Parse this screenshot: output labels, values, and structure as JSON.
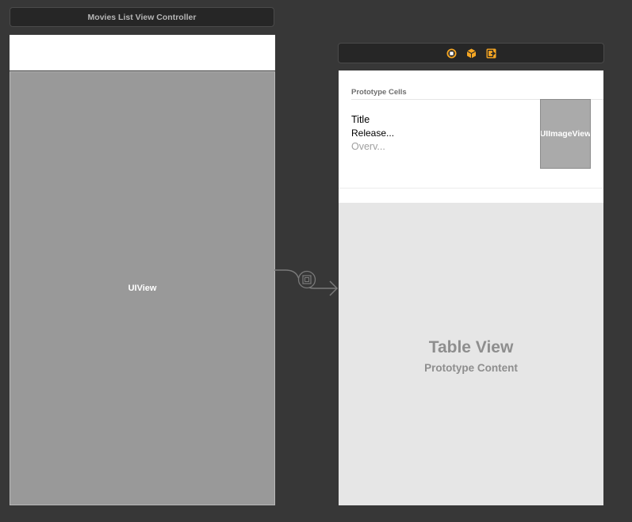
{
  "left_scene": {
    "title": "Movies List View Controller",
    "main_view_label": "UIView"
  },
  "right_scene": {
    "dock_icons": [
      "view-controller-icon",
      "first-responder-icon",
      "exit-icon"
    ],
    "prototype_header": "Prototype Cells",
    "cell": {
      "title": "Title",
      "release": "Release...",
      "overview": "Overv...",
      "image_label": "UIImageView"
    },
    "placeholder": {
      "title": "Table View",
      "subtitle": "Prototype Content"
    }
  },
  "colors": {
    "canvas": "#373737",
    "scene_bar": "#262626",
    "dock_accent": "#f5a623",
    "view_gray": "#999999",
    "placeholder_bg": "#e6e6e6"
  }
}
